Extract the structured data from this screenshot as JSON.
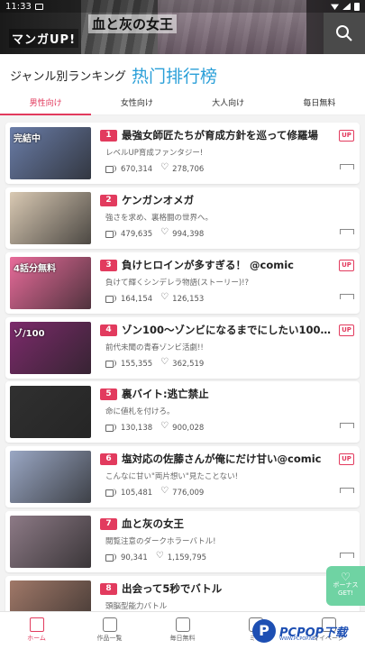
{
  "status_bar": {
    "time": "11:33"
  },
  "header": {
    "logo": "マンガUP!",
    "banner_title": "血と灰の女王"
  },
  "ranking": {
    "title_jp": "ジャンル別ランキング",
    "title_cn": "热门排行榜"
  },
  "tabs": [
    {
      "label": "男性向け",
      "active": true
    },
    {
      "label": "女性向け",
      "active": false
    },
    {
      "label": "大人向け",
      "active": false
    },
    {
      "label": "毎日無料",
      "active": false
    }
  ],
  "items": [
    {
      "rank": "1",
      "title": "最強女師匠たちが育成方針を巡って修羅場",
      "subtitle": "レベルUP育成ファンタジー!",
      "views": "670,314",
      "likes": "278,706",
      "up": true,
      "original": true,
      "thumb_color": "#6a7da8",
      "thumb_text": "完結中"
    },
    {
      "rank": "2",
      "title": "ケンガンオメガ",
      "subtitle": "強さを求め、裏格闘の世界へ。",
      "views": "479,635",
      "likes": "994,398",
      "up": false,
      "original": true,
      "thumb_color": "#d9c9b3",
      "thumb_text": ""
    },
    {
      "rank": "3",
      "title": "負けヒロインが多すぎる！ @comic",
      "subtitle": "負けて輝くシンデレラ物語(ストーリー)!?",
      "views": "164,154",
      "likes": "126,153",
      "up": true,
      "original": true,
      "thumb_color": "#e86b9a",
      "thumb_text": "4話分無料"
    },
    {
      "rank": "4",
      "title": "ゾン100～ゾンビになるまでにしたい100のこと～",
      "subtitle": "前代未聞の青春ゾンビ活劇!!",
      "views": "155,355",
      "likes": "362,519",
      "up": true,
      "original": false,
      "thumb_color": "#7c2a6b",
      "thumb_text": "ゾ/100"
    },
    {
      "rank": "5",
      "title": "裏バイト:逃亡禁止",
      "subtitle": "命に値札を付けろ。",
      "views": "130,138",
      "likes": "900,028",
      "up": false,
      "original": true,
      "thumb_color": "#303030",
      "thumb_text": ""
    },
    {
      "rank": "6",
      "title": "塩対応の佐藤さんが俺にだけ甘い@comic",
      "subtitle": "こんなに甘い\"両片想い\"見たことない!",
      "views": "105,481",
      "likes": "776,009",
      "up": true,
      "original": true,
      "thumb_color": "#9aa7c4",
      "thumb_text": ""
    },
    {
      "rank": "7",
      "title": "血と灰の女王",
      "subtitle": "閲覧注意のダークホラーバトル!",
      "views": "90,341",
      "likes": "1,159,795",
      "up": false,
      "original": true,
      "thumb_color": "#8d7a86",
      "thumb_text": ""
    },
    {
      "rank": "8",
      "title": "出会って5秒でバトル",
      "subtitle": "頭脳型能力バトル",
      "views": "",
      "likes": "",
      "up": false,
      "original": false,
      "thumb_color": "#a07868",
      "thumb_text": ""
    }
  ],
  "bonus": {
    "line1": "ボーナス",
    "line2": "GET!"
  },
  "bottom_nav": [
    {
      "label": "ホーム",
      "icon": "home-icon",
      "active": true
    },
    {
      "label": "作品一覧",
      "icon": "books-icon",
      "active": false
    },
    {
      "label": "毎日無料",
      "icon": "free-ticket-icon",
      "active": false
    },
    {
      "label": "ミッ",
      "icon": "mission-icon",
      "active": false
    },
    {
      "label": "マイページ",
      "icon": "mypage-icon",
      "active": false
    }
  ],
  "watermark": {
    "text": "PCPOP下载",
    "sub": "WWW.PCPOP.NET"
  }
}
